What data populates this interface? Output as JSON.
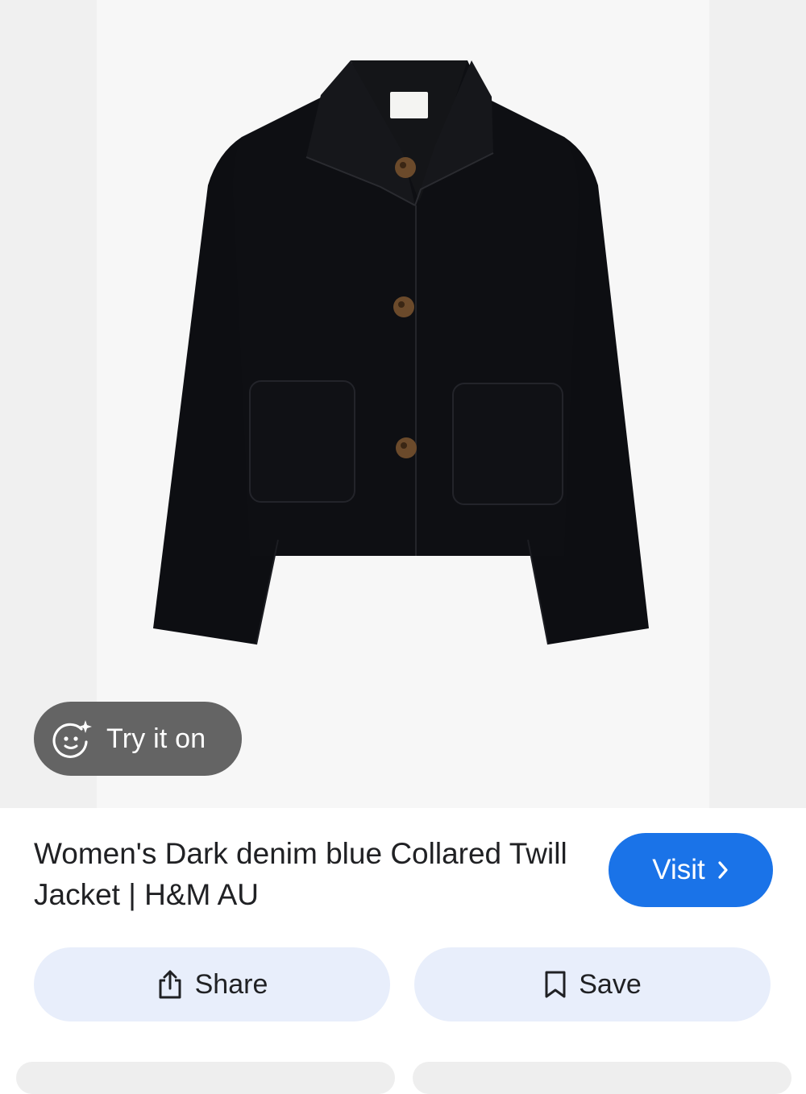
{
  "image": {
    "alt": "Women's Dark denim blue Collared Twill Jacket",
    "try_on_label": "Try it on",
    "try_on_icon": "face-sparkle-icon"
  },
  "product": {
    "title": "Women's Dark denim blue Collared Twill Jacket | H&M AU"
  },
  "actions": {
    "visit_label": "Visit",
    "visit_icon": "chevron-right-icon",
    "share_label": "Share",
    "share_icon": "share-icon",
    "save_label": "Save",
    "save_icon": "bookmark-icon"
  },
  "colors": {
    "accent": "#1a73e8",
    "action_bg": "#e8eefb",
    "try_on_bg": "#505050",
    "jacket": "#0d0e12",
    "button_brown": "#6b4a2b"
  }
}
